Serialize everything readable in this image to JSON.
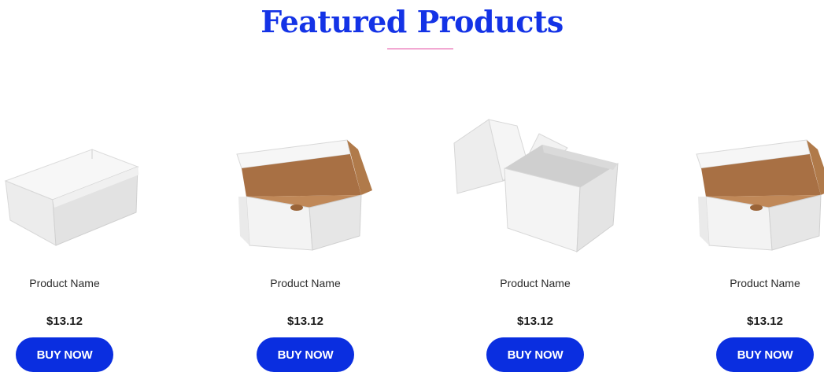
{
  "section": {
    "title": "Featured Products"
  },
  "colors": {
    "title": "#1433e6",
    "underline": "#f2a8d2",
    "button": "#0a2ee0",
    "box_white": "#f2f2f2",
    "box_shadow": "#d6d6d6",
    "box_kraft": "#b07a4a"
  },
  "products": [
    {
      "name": "Product Name",
      "price": "$13.12",
      "button_label": "BUY NOW",
      "image": "closed-white-box-image"
    },
    {
      "name": "Product Name",
      "price": "$13.12",
      "button_label": "BUY NOW",
      "image": "open-mailer-box-image"
    },
    {
      "name": "Product Name",
      "price": "$13.12",
      "button_label": "BUY NOW",
      "image": "open-cake-box-image"
    },
    {
      "name": "Product Name",
      "price": "$13.12",
      "button_label": "BUY NOW",
      "image": "open-mailer-box-image"
    }
  ]
}
